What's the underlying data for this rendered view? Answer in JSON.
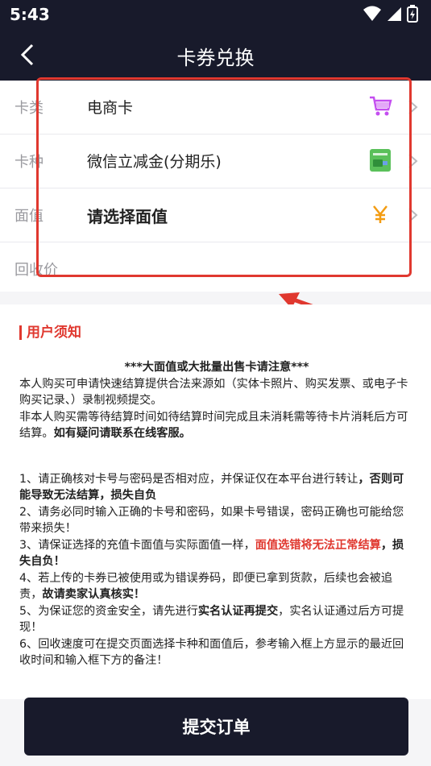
{
  "status": {
    "time": "5:43"
  },
  "header": {
    "title": "卡券兑换"
  },
  "form": {
    "rows": [
      {
        "label": "卡类",
        "value": "电商卡",
        "icon": "shopping-cart-icon"
      },
      {
        "label": "卡种",
        "value": "微信立减金(分期乐)",
        "icon": "gift-card-icon"
      },
      {
        "label": "面值",
        "value": "请选择面值",
        "icon": "yuan-icon"
      },
      {
        "label": "回收价",
        "value": ""
      }
    ]
  },
  "notice": {
    "title": "用户须知",
    "warning": "***大面值或大批量出售卡请注意***",
    "p1": "本人购买可申请快速结算提供合法来源如（实体卡照片、购买发票、或电子卡购买记录、）录制视频提交。",
    "p2_a": "非本人购买需等待结算时间如待结算时间完成且未消耗需等待卡片消耗后方可结算。",
    "p2_b": "如有疑问请联系在线客服。",
    "i1_a": "1、请正确核对卡号与密码是否相对应，并保证仅在本平台进行转让",
    "i1_b": "，否则可能导致无法结算，损失自负",
    "i2": "2、请务必同时输入正确的卡号和密码，如果卡号错误，密码正确也可能给您带来损失！",
    "i3_a": "3、请保证选择的充值卡面值与实际面值一样，",
    "i3_b": "面值选错将无法正常结算",
    "i3_c": "，损失自负！",
    "i4_a": "4、若上传的卡券已被使用或为错误券码，即便已拿到货款，后续也会被追责，",
    "i4_b": "故请卖家认真核实！",
    "i5_a": "5、为保证您的资金安全，请先进行",
    "i5_b": "实名认证再提交",
    "i5_c": "，实名认证通过后方可提现！",
    "i6": "6、回收速度可在提交页面选择卡种和面值后，参考输入框上方显示的最近回收时间和输入框下方的备注！"
  },
  "submit": {
    "label": "提交订单"
  },
  "colors": {
    "dark": "#181a2b",
    "accent": "#e0382f",
    "cart": "#c44ef0",
    "yuan": "#f39c12",
    "card_green": "#5ac05a"
  }
}
